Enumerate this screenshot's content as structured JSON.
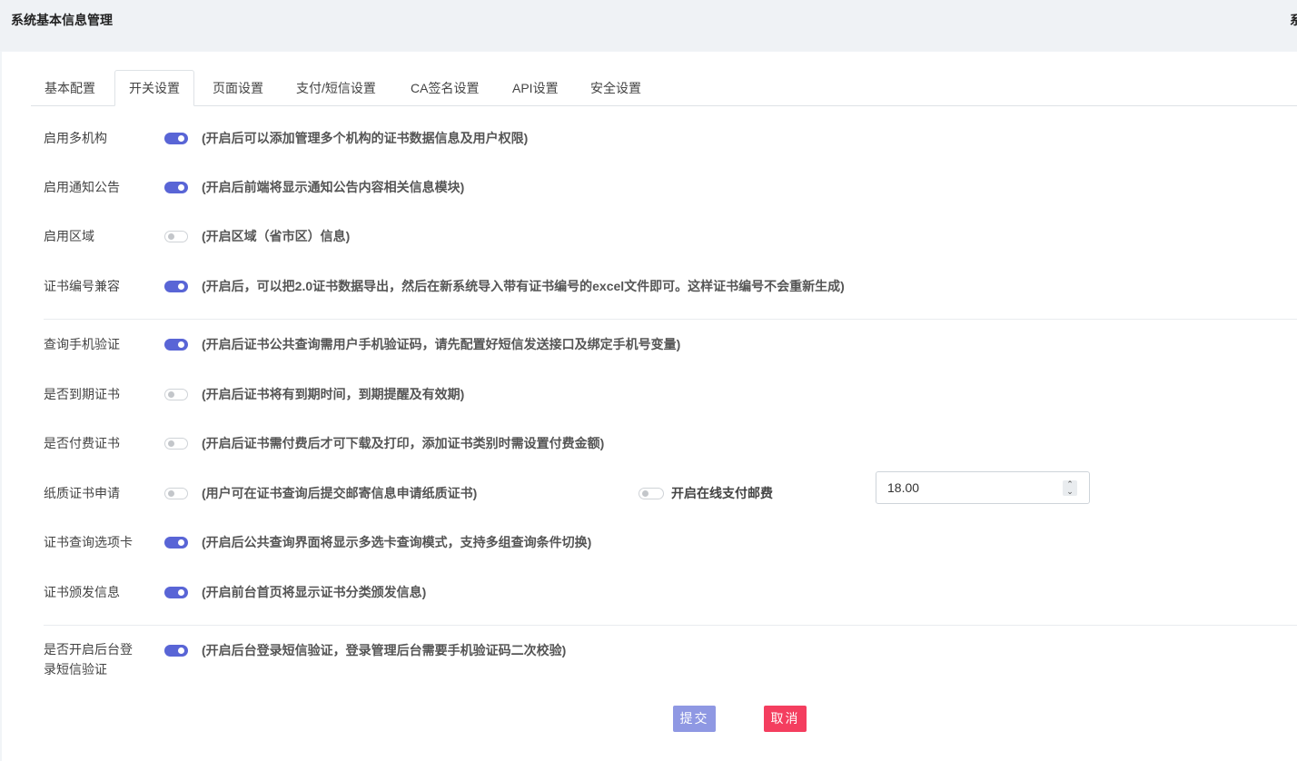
{
  "header": {
    "title": "系统基本信息管理",
    "edge_text": "系"
  },
  "tabs": [
    {
      "label": "基本配置"
    },
    {
      "label": "开关设置"
    },
    {
      "label": "页面设置"
    },
    {
      "label": "支付/短信设置"
    },
    {
      "label": "CA签名设置"
    },
    {
      "label": "API设置"
    },
    {
      "label": "安全设置"
    }
  ],
  "active_tab": "开关设置",
  "settings": [
    {
      "label": "启用多机构",
      "enabled": true,
      "desc": "(开启后可以添加管理多个机构的证书数据信息及用户权限)"
    },
    {
      "label": "启用通知公告",
      "enabled": true,
      "desc": "(开启后前端将显示通知公告内容相关信息模块)"
    },
    {
      "label": "启用区域",
      "enabled": false,
      "desc": "(开启区域（省市区）信息)"
    },
    {
      "label": "证书编号兼容",
      "enabled": true,
      "desc": "(开启后，可以把2.0证书数据导出，然后在新系统导入带有证书编号的excel文件即可。这样证书编号不会重新生成)"
    },
    {
      "label": "查询手机验证",
      "enabled": true,
      "desc": "(开启后证书公共查询需用户手机验证码，请先配置好短信发送接口及绑定手机号变量)"
    },
    {
      "label": "是否到期证书",
      "enabled": false,
      "desc": "(开启后证书将有到期时间，到期提醒及有效期)"
    },
    {
      "label": "是否付费证书",
      "enabled": false,
      "desc": "(开启后证书需付费后才可下载及打印，添加证书类别时需设置付费金额)"
    },
    {
      "label": "纸质证书申请",
      "enabled": false,
      "desc": "(用户可在证书查询后提交邮寄信息申请纸质证书)"
    },
    {
      "label": "证书查询选项卡",
      "enabled": true,
      "desc": "(开启后公共查询界面将显示多选卡查询模式，支持多组查询条件切换)"
    },
    {
      "label": "证书颁发信息",
      "enabled": true,
      "desc": "(开启前台首页将显示证书分类颁发信息)"
    },
    {
      "label": "是否开启后台登录短信验证",
      "enabled": true,
      "desc": "(开启后台登录短信验证，登录管理后台需要手机验证码二次校验)"
    }
  ],
  "postage": {
    "label": "开启在线支付邮费",
    "enabled": false,
    "value": "18.00"
  },
  "buttons": {
    "submit": "提交",
    "cancel": "取消"
  },
  "colors": {
    "switch_on": "#5965d6",
    "submit": "#8f98e3",
    "cancel": "#f43e5f"
  }
}
